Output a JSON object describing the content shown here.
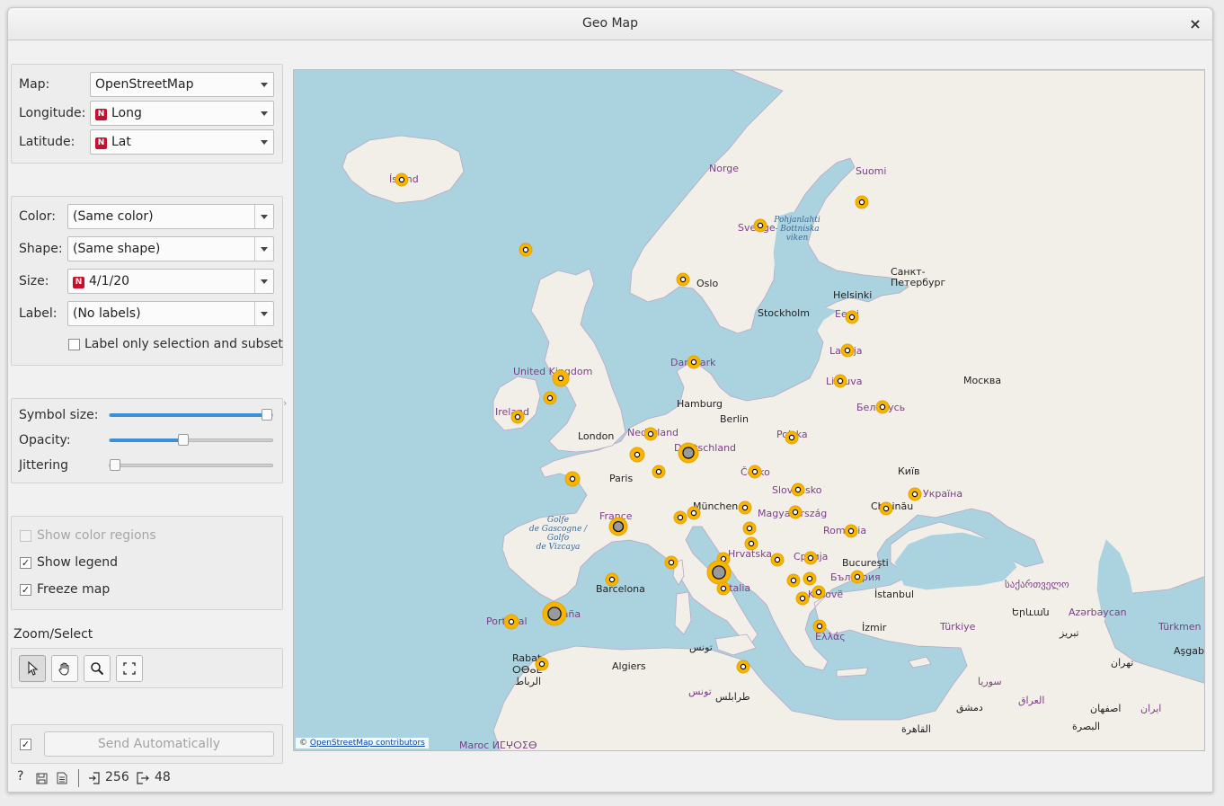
{
  "window": {
    "title": "Geo Map",
    "close_glyph": "×"
  },
  "settings": {
    "map_label": "Map:",
    "map_value": "OpenStreetMap",
    "longitude_label": "Longitude:",
    "longitude_value": "Long",
    "latitude_label": "Latitude:",
    "latitude_value": "Lat",
    "var_badge": "N"
  },
  "attributes": {
    "color_label": "Color:",
    "color_value": "(Same color)",
    "shape_label": "Shape:",
    "shape_value": "(Same shape)",
    "size_label": "Size:",
    "size_value": "4/1/20",
    "label_label": "Label:",
    "label_value": "(No labels)",
    "label_only_selection": "Label only selection and subset"
  },
  "sliders": [
    {
      "label": "Symbol size:",
      "value": 1.0
    },
    {
      "label": "Opacity:",
      "value": 0.45
    },
    {
      "label": "Jittering",
      "value": 0.0
    }
  ],
  "options": {
    "show_color_regions": "Show color regions",
    "show_color_regions_checked": false,
    "show_color_regions_enabled": false,
    "show_legend": "Show legend",
    "show_legend_checked": true,
    "freeze_map": "Freeze map",
    "freeze_map_checked": true
  },
  "zoom": {
    "title": "Zoom/Select",
    "tools": [
      "pointer-icon",
      "pan-hand-icon",
      "zoom-icon",
      "fit-extent-icon"
    ]
  },
  "send": {
    "label": "Send Automatically",
    "auto_checked": true
  },
  "status": {
    "input_count": "256",
    "output_count": "48"
  },
  "map": {
    "attribution_prefix": "©",
    "attribution_link": "OpenStreetMap contributors",
    "places": {
      "norge": "Norge",
      "suomi": "Suomi",
      "sverige": "Sverige",
      "island": "Ísland",
      "oslo": "Oslo",
      "stockholm": "Stockholm",
      "helsinki": "Helsinki",
      "spb": "Санкт-\nПетербург",
      "eesti": "Eesti",
      "latvija": "Latvija",
      "lietuva": "Lietuva",
      "moskva": "Москва",
      "belarus": "Беларусь",
      "danmark": "Danmark",
      "uk": "United Kingdom",
      "ireland": "Ireland",
      "hamburg": "Hamburg",
      "berlin": "Berlin",
      "london": "London",
      "nederland": "Nederland",
      "deutschland": "Deutschland",
      "polska": "Polska",
      "paris": "Paris",
      "cesko": "Česko",
      "kyiv": "Київ",
      "slovensko": "Slovensko",
      "ukraina": "Україна",
      "munchen": "München",
      "chisinau": "Chișinău",
      "france": "France",
      "magyar": "Magyarország",
      "romania": "România",
      "hrvatska": "Hrvatska",
      "srbija": "Србија",
      "bucuresti": "București",
      "bulgaria": "България",
      "istanbul": "İstanbul",
      "italia": "Italia",
      "barcelona": "Barcelona",
      "kosovo": "Kosovë",
      "portugal": "Portugal",
      "espana": "España",
      "ellas": "Ελλάς",
      "izmir": "İzmir",
      "turkiye": "Türkiye",
      "georgia": "საქართველო",
      "yerevan": "Երևան",
      "azerbaijan": "Azərbaycan",
      "turkmen": "Türkmen",
      "asgabat": "Aşgabat",
      "tebriz": "تبريز",
      "tehran": "تهران",
      "isfahan": "اصفهان",
      "iran": "ایران",
      "iraq": "العراق",
      "basra": "البصرة",
      "syria": "سوريا",
      "damascus": "دمشق",
      "cairo": "القاهرة",
      "tunis": "تونس",
      "tunisia": "تونس",
      "tripoli": "طرابلس",
      "algiers": "Algiers",
      "rabat": "Rabat",
      "tifinagh": "ⵔⴱⴰⵟ",
      "rabat_ar": "الرباط",
      "maroc": "Maroc ⵍⵎⵖⵔⵉⴱ",
      "golfe": "Golfe\nde Gascogne /\nGolfo\nde Vizcaya",
      "bothnia": "Pohjanlahti\n- Bottniska\nviken"
    }
  }
}
